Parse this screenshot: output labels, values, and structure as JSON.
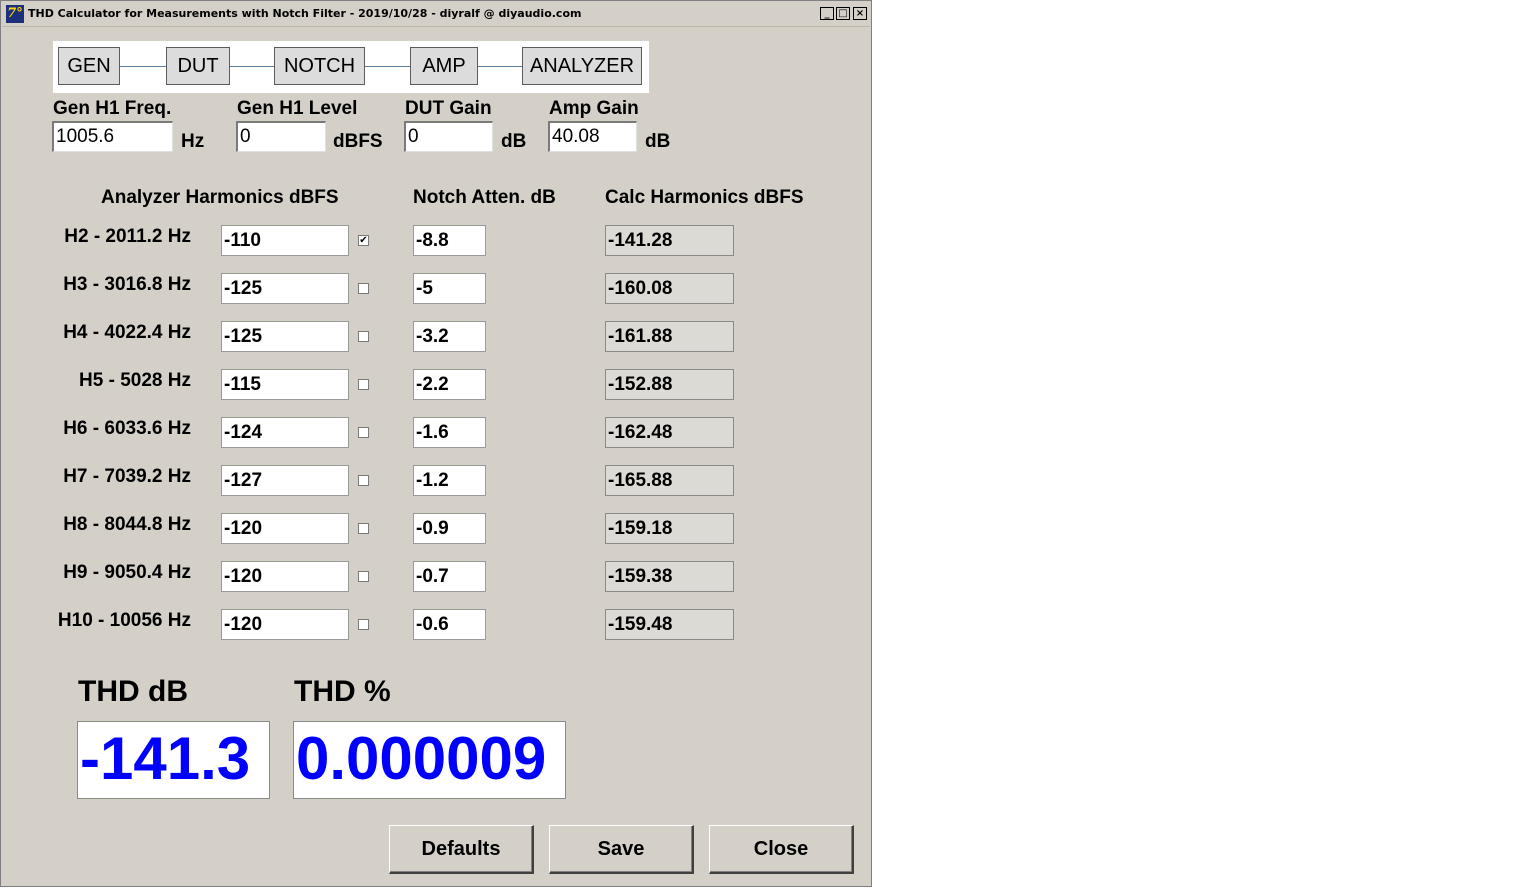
{
  "window": {
    "title": "THD Calculator for Measurements with Notch Filter - 2019/10/28 - diyralf @ diyaudio.com",
    "app_icon": "7°",
    "controls": {
      "minimize": "_",
      "maximize": "□",
      "close": "×"
    }
  },
  "chain": [
    "GEN",
    "DUT",
    "NOTCH",
    "AMP",
    "ANALYZER"
  ],
  "params": {
    "gen_freq": {
      "label": "Gen H1 Freq.",
      "value": "1005.6",
      "unit": "Hz"
    },
    "gen_level": {
      "label": "Gen H1 Level",
      "value": "0",
      "unit": "dBFS"
    },
    "dut_gain": {
      "label": "DUT Gain",
      "value": "0",
      "unit": "dB"
    },
    "amp_gain": {
      "label": "Amp Gain",
      "value": "40.08",
      "unit": "dB"
    }
  },
  "headers": {
    "analyzer": "Analyzer Harmonics dBFS",
    "notch": "Notch Atten. dB",
    "calc": "Calc Harmonics dBFS"
  },
  "harmonics": [
    {
      "label": "H2 - 2011.2 Hz",
      "analyzer": "-110",
      "checked": "✔",
      "notch": "-8.8",
      "calc": "-141.28"
    },
    {
      "label": "H3 - 3016.8 Hz",
      "analyzer": "-125",
      "checked": "",
      "notch": "-5",
      "calc": "-160.08"
    },
    {
      "label": "H4 - 4022.4 Hz",
      "analyzer": "-125",
      "checked": "",
      "notch": "-3.2",
      "calc": "-161.88"
    },
    {
      "label": "H5 - 5028 Hz",
      "analyzer": "-115",
      "checked": "",
      "notch": "-2.2",
      "calc": "-152.88"
    },
    {
      "label": "H6 - 6033.6 Hz",
      "analyzer": "-124",
      "checked": "",
      "notch": "-1.6",
      "calc": "-162.48"
    },
    {
      "label": "H7 - 7039.2 Hz",
      "analyzer": "-127",
      "checked": "",
      "notch": "-1.2",
      "calc": "-165.88"
    },
    {
      "label": "H8 - 8044.8 Hz",
      "analyzer": "-120",
      "checked": "",
      "notch": "-0.9",
      "calc": "-159.18"
    },
    {
      "label": "H9 - 9050.4 Hz",
      "analyzer": "-120",
      "checked": "",
      "notch": "-0.7",
      "calc": "-159.38"
    },
    {
      "label": "H10 - 10056 Hz",
      "analyzer": "-120",
      "checked": "",
      "notch": "-0.6",
      "calc": "-159.48"
    }
  ],
  "thd": {
    "db_label": "THD dB",
    "db_value": "-141.3",
    "pct_label": "THD %",
    "pct_value": "0.000009",
    "value_color": "#0000ff"
  },
  "buttons": {
    "defaults": "Defaults",
    "save": "Save",
    "close": "Close"
  }
}
